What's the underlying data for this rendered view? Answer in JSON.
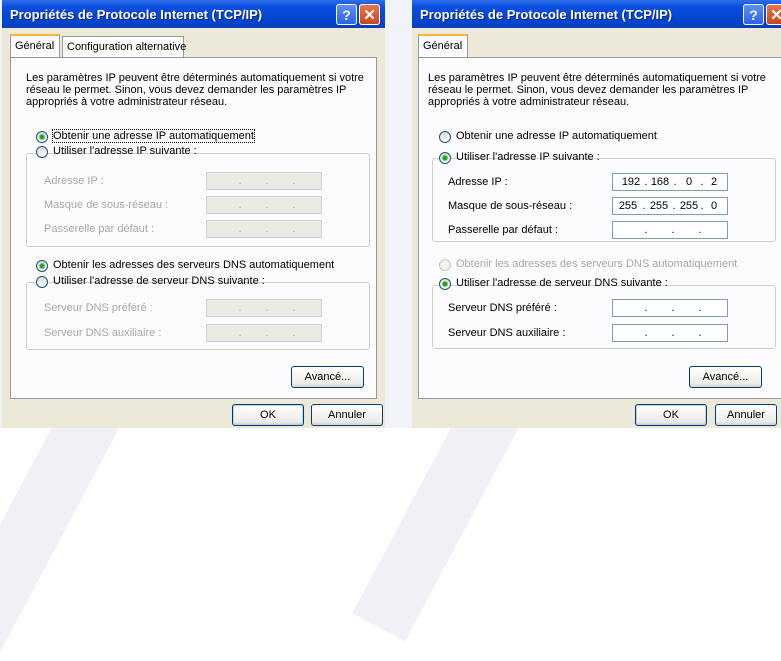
{
  "dialog_title": "Propriétés de Protocole Internet (TCP/IP)",
  "titlebar_buttons": {
    "help": "?",
    "close": "✕"
  },
  "left": {
    "tabs": [
      "Général",
      "Configuration alternative"
    ],
    "description": "Les paramètres IP peuvent être déterminés automatiquement si votre\nréseau le permet. Sinon, vous devez demander les paramètres IP\nappropriés à votre administrateur réseau.",
    "radio_auto_ip": "Obtenir une adresse IP automatiquement",
    "radio_manual_ip": "Utiliser l'adresse IP suivante :",
    "ip_address_label": "Adresse IP :",
    "subnet_mask_label": "Masque de sous-réseau :",
    "gateway_label": "Passerelle par défaut :",
    "radio_auto_dns": "Obtenir les adresses des serveurs DNS automatiquement",
    "radio_manual_dns": "Utiliser l'adresse de serveur DNS suivante :",
    "preferred_dns_label": "Serveur DNS préféré :",
    "alternate_dns_label": "Serveur DNS auxiliaire :",
    "advanced_button": "Avancé...",
    "ok_button": "OK",
    "cancel_button": "Annuler"
  },
  "right": {
    "tabs": [
      "Général"
    ],
    "description": "Les paramètres IP peuvent être déterminés automatiquement si votre\nréseau le permet. Sinon, vous devez demander les paramètres IP\nappropriés à votre administrateur réseau.",
    "radio_auto_ip": "Obtenir une adresse IP automatiquement",
    "radio_manual_ip": "Utiliser l'adresse IP suivante :",
    "ip_address_label": "Adresse IP :",
    "ip_address": [
      "192",
      "168",
      "0",
      "2"
    ],
    "subnet_mask_label": "Masque de sous-réseau :",
    "subnet_mask": [
      "255",
      "255",
      "255",
      "0"
    ],
    "gateway_label": "Passerelle par défaut :",
    "radio_auto_dns": "Obtenir les adresses des serveurs DNS automatiquement",
    "radio_manual_dns": "Utiliser l'adresse de serveur DNS suivante :",
    "preferred_dns_label": "Serveur DNS préféré :",
    "alternate_dns_label": "Serveur DNS auxiliaire :",
    "advanced_button": "Avancé...",
    "ok_button": "OK",
    "cancel_button": "Annuler"
  },
  "colors": {
    "titlebar": "#0a4fe0",
    "dialog_bg": "#ece9d8",
    "tab_accent": "#f7b53c",
    "radio_dot": "#21a121"
  }
}
